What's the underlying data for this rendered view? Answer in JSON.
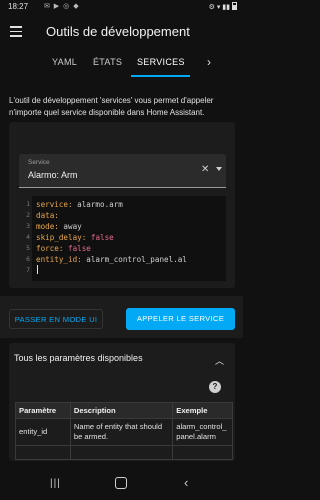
{
  "status_bar": {
    "time": "18:27",
    "notification_icons": "✉ ▶ ◎ ◆",
    "system_icons": "⚙ ▾ ▮▮"
  },
  "header": {
    "title": "Outils de développement",
    "tabs": [
      {
        "label": "YAML",
        "active": false
      },
      {
        "label": "ÉTATS",
        "active": false
      },
      {
        "label": "SERVICES",
        "active": true
      }
    ],
    "next_arrow": "›",
    "accent_color": "#03a9f4"
  },
  "description": "L'outil de développement 'services' vous permet d'appeler n'importe quel service disponible dans Home Assistant.",
  "service_select": {
    "label": "Service",
    "value": "Alarmo: Arm",
    "clear": "✕"
  },
  "editor": {
    "lines": [
      {
        "n": "1",
        "key": "service:",
        "val": " alarmo.arm",
        "type": "str"
      },
      {
        "n": "2",
        "key": "data:",
        "val": "",
        "type": "str"
      },
      {
        "n": "3",
        "key": "  mode:",
        "val": " away",
        "type": "str"
      },
      {
        "n": "4",
        "key": "  skip_delay:",
        "val": " false",
        "type": "bool"
      },
      {
        "n": "5",
        "key": "  force:",
        "val": " false",
        "type": "bool"
      },
      {
        "n": "6",
        "key": "  entity_id:",
        "val": " alarm_control_panel.al",
        "type": "str"
      },
      {
        "n": "7",
        "key": "",
        "val": "",
        "type": "str"
      }
    ]
  },
  "actions": {
    "yaml_mode_label": "PASSER EN MODE UI",
    "call_service_label": "APPELER LE SERVICE"
  },
  "params": {
    "title": "Tous les paramètres disponibles",
    "chevron": "︿",
    "help": "?",
    "columns": [
      "Paramètre",
      "Description",
      "Exemple"
    ],
    "rows": [
      {
        "param": "entity_id",
        "description": "Name of entity that should be armed.",
        "example": "alarm_control_panel.alarm"
      }
    ]
  },
  "navbar": {
    "recent": "|||",
    "back": "‹"
  }
}
